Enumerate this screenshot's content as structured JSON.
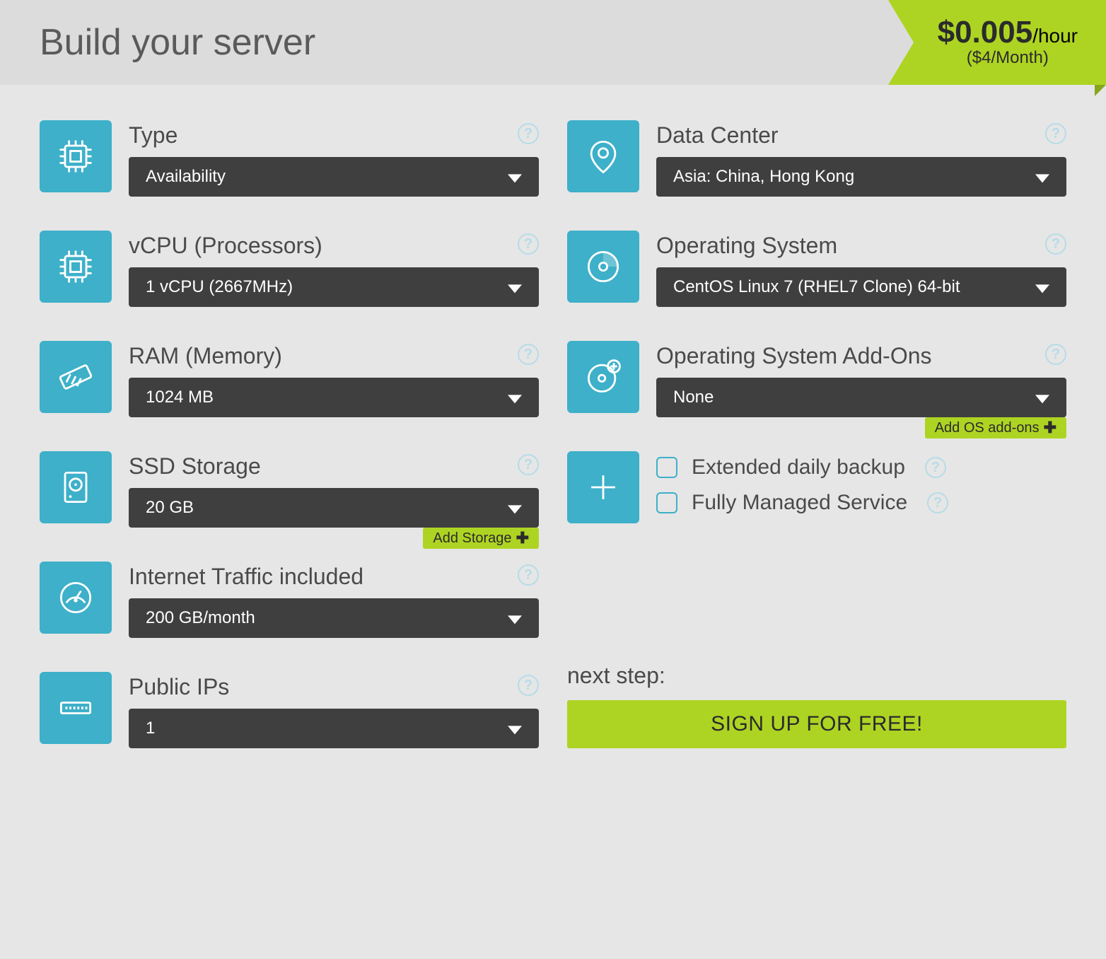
{
  "header": {
    "title": "Build your server",
    "price_hour": "$0.005",
    "price_hour_unit": "/hour",
    "price_month": "($4/Month)"
  },
  "left": {
    "type": {
      "label": "Type",
      "value": "Availability"
    },
    "vcpu": {
      "label": "vCPU (Processors)",
      "value": "1 vCPU (2667MHz)"
    },
    "ram": {
      "label": "RAM (Memory)",
      "value": "1024 MB"
    },
    "ssd": {
      "label": "SSD Storage",
      "value": "20 GB",
      "add": "Add Storage"
    },
    "traffic": {
      "label": "Internet Traffic included",
      "value": "200 GB/month"
    },
    "ips": {
      "label": "Public IPs",
      "value": "1"
    }
  },
  "right": {
    "dc": {
      "label": "Data Center",
      "value": "Asia: China, Hong Kong"
    },
    "os": {
      "label": "Operating System",
      "value": "CentOS Linux 7 (RHEL7 Clone) 64-bit"
    },
    "addons": {
      "label": "Operating System Add-Ons",
      "value": "None",
      "add": "Add OS add-ons"
    },
    "extras": {
      "backup": "Extended daily backup",
      "managed": "Fully Managed Service"
    }
  },
  "next": {
    "label": "next step:",
    "button": "SIGN UP FOR FREE!"
  }
}
